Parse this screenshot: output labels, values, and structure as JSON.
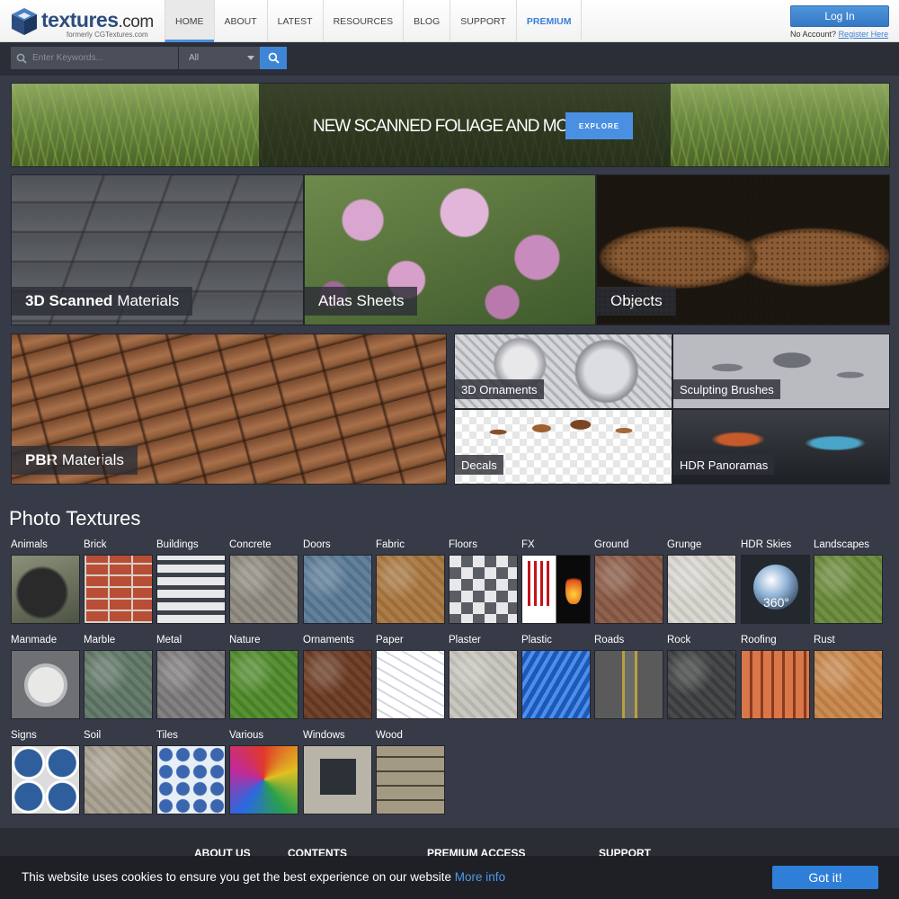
{
  "header": {
    "logo_text": "textures",
    "logo_suffix": ".com",
    "logo_sub": "formerly CGTextures.com",
    "nav": [
      "HOME",
      "ABOUT",
      "LATEST",
      "RESOURCES",
      "BLOG",
      "SUPPORT",
      "PREMIUM"
    ],
    "login_label": "Log In",
    "no_account": "No Account?",
    "register_link": "Register Here"
  },
  "search": {
    "placeholder": "Enter Keywords...",
    "select_value": "All"
  },
  "banner": {
    "title": "NEW SCANNED FOLIAGE AND MORE!",
    "button": "EXPLORE"
  },
  "tiles": {
    "scanned_bold": "3D Scanned",
    "scanned_rest": "Materials",
    "atlas": "Atlas Sheets",
    "objects": "Objects",
    "pbr_bold": "PBR",
    "pbr_rest": "Materials",
    "ornaments": "3D Ornaments",
    "brushes": "Sculpting Brushes",
    "decals": "Decals",
    "hdr": "HDR Panoramas"
  },
  "photo_textures": {
    "title": "Photo Textures",
    "categories": [
      {
        "label": "Animals",
        "icon": "gorilla-thumb",
        "color": "#6d7062"
      },
      {
        "label": "Brick",
        "icon": "brick-thumb",
        "color": "#b84e36"
      },
      {
        "label": "Buildings",
        "icon": "buildings-thumb",
        "color": "#c8ccd0"
      },
      {
        "label": "Concrete",
        "icon": "concrete-thumb",
        "color": "#8e8a80"
      },
      {
        "label": "Doors",
        "icon": "doors-thumb",
        "color": "#5a7a96"
      },
      {
        "label": "Fabric",
        "icon": "fabric-thumb",
        "color": "#a8763e"
      },
      {
        "label": "Floors",
        "icon": "floors-thumb",
        "color": "#9a9ca2"
      },
      {
        "label": "FX",
        "icon": "fx-thumb",
        "color": "#d0202a"
      },
      {
        "label": "Ground",
        "icon": "ground-thumb",
        "color": "#8a5a44"
      },
      {
        "label": "Grunge",
        "icon": "grunge-thumb",
        "color": "#d8d6cf"
      },
      {
        "label": "HDR Skies",
        "icon": "hdr-skies-thumb",
        "color": "#22262c"
      },
      {
        "label": "Landscapes",
        "icon": "landscapes-thumb",
        "color": "#6a8a3a"
      },
      {
        "label": "Manmade",
        "icon": "gauge-thumb",
        "color": "#6e7074"
      },
      {
        "label": "Marble",
        "icon": "marble-thumb",
        "color": "#5f7666"
      },
      {
        "label": "Metal",
        "icon": "metal-thumb",
        "color": "#7d7a7c"
      },
      {
        "label": "Nature",
        "icon": "nature-thumb",
        "color": "#4f8a2a"
      },
      {
        "label": "Ornaments",
        "icon": "ornaments-thumb",
        "color": "#6a3a22"
      },
      {
        "label": "Paper",
        "icon": "paper-thumb",
        "color": "#e4e6ea"
      },
      {
        "label": "Plaster",
        "icon": "plaster-thumb",
        "color": "#c6c4bc"
      },
      {
        "label": "Plastic",
        "icon": "plastic-thumb",
        "color": "#2c6ed4"
      },
      {
        "label": "Roads",
        "icon": "roads-thumb",
        "color": "#6c6c6c"
      },
      {
        "label": "Rock",
        "icon": "rock-thumb",
        "color": "#3e3f40"
      },
      {
        "label": "Roofing",
        "icon": "roofing-thumb",
        "color": "#c05a36"
      },
      {
        "label": "Rust",
        "icon": "rust-thumb",
        "color": "#c8864a"
      },
      {
        "label": "Signs",
        "icon": "signs-thumb",
        "color": "#2e5f9c"
      },
      {
        "label": "Soil",
        "icon": "soil-thumb",
        "color": "#a79e8e"
      },
      {
        "label": "Tiles",
        "icon": "tiles-thumb",
        "color": "#3a66b0"
      },
      {
        "label": "Various",
        "icon": "various-thumb",
        "color": "#e0c020"
      },
      {
        "label": "Windows",
        "icon": "windows-thumb",
        "color": "#b8b4a8"
      },
      {
        "label": "Wood",
        "icon": "wood-thumb",
        "color": "#8f8570"
      }
    ],
    "hdr_badge": "360°"
  },
  "footer": {
    "columns": [
      "ABOUT US",
      "CONTENTS",
      "PREMIUM ACCESS",
      "SUPPORT"
    ]
  },
  "cookie": {
    "text": "This website uses cookies to ensure you get the best experience on our website",
    "more_info": "More info",
    "button": "Got it!"
  }
}
